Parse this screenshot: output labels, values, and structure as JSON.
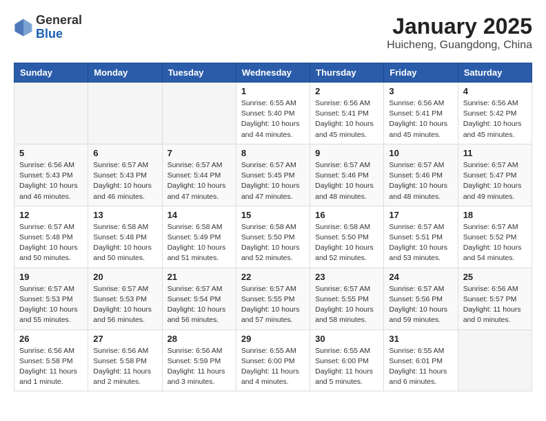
{
  "header": {
    "logo_general": "General",
    "logo_blue": "Blue",
    "title": "January 2025",
    "location": "Huicheng, Guangdong, China"
  },
  "weekdays": [
    "Sunday",
    "Monday",
    "Tuesday",
    "Wednesday",
    "Thursday",
    "Friday",
    "Saturday"
  ],
  "weeks": [
    [
      {
        "day": "",
        "info": ""
      },
      {
        "day": "",
        "info": ""
      },
      {
        "day": "",
        "info": ""
      },
      {
        "day": "1",
        "info": "Sunrise: 6:55 AM\nSunset: 5:40 PM\nDaylight: 10 hours\nand 44 minutes."
      },
      {
        "day": "2",
        "info": "Sunrise: 6:56 AM\nSunset: 5:41 PM\nDaylight: 10 hours\nand 45 minutes."
      },
      {
        "day": "3",
        "info": "Sunrise: 6:56 AM\nSunset: 5:41 PM\nDaylight: 10 hours\nand 45 minutes."
      },
      {
        "day": "4",
        "info": "Sunrise: 6:56 AM\nSunset: 5:42 PM\nDaylight: 10 hours\nand 45 minutes."
      }
    ],
    [
      {
        "day": "5",
        "info": "Sunrise: 6:56 AM\nSunset: 5:43 PM\nDaylight: 10 hours\nand 46 minutes."
      },
      {
        "day": "6",
        "info": "Sunrise: 6:57 AM\nSunset: 5:43 PM\nDaylight: 10 hours\nand 46 minutes."
      },
      {
        "day": "7",
        "info": "Sunrise: 6:57 AM\nSunset: 5:44 PM\nDaylight: 10 hours\nand 47 minutes."
      },
      {
        "day": "8",
        "info": "Sunrise: 6:57 AM\nSunset: 5:45 PM\nDaylight: 10 hours\nand 47 minutes."
      },
      {
        "day": "9",
        "info": "Sunrise: 6:57 AM\nSunset: 5:46 PM\nDaylight: 10 hours\nand 48 minutes."
      },
      {
        "day": "10",
        "info": "Sunrise: 6:57 AM\nSunset: 5:46 PM\nDaylight: 10 hours\nand 48 minutes."
      },
      {
        "day": "11",
        "info": "Sunrise: 6:57 AM\nSunset: 5:47 PM\nDaylight: 10 hours\nand 49 minutes."
      }
    ],
    [
      {
        "day": "12",
        "info": "Sunrise: 6:57 AM\nSunset: 5:48 PM\nDaylight: 10 hours\nand 50 minutes."
      },
      {
        "day": "13",
        "info": "Sunrise: 6:58 AM\nSunset: 5:48 PM\nDaylight: 10 hours\nand 50 minutes."
      },
      {
        "day": "14",
        "info": "Sunrise: 6:58 AM\nSunset: 5:49 PM\nDaylight: 10 hours\nand 51 minutes."
      },
      {
        "day": "15",
        "info": "Sunrise: 6:58 AM\nSunset: 5:50 PM\nDaylight: 10 hours\nand 52 minutes."
      },
      {
        "day": "16",
        "info": "Sunrise: 6:58 AM\nSunset: 5:50 PM\nDaylight: 10 hours\nand 52 minutes."
      },
      {
        "day": "17",
        "info": "Sunrise: 6:57 AM\nSunset: 5:51 PM\nDaylight: 10 hours\nand 53 minutes."
      },
      {
        "day": "18",
        "info": "Sunrise: 6:57 AM\nSunset: 5:52 PM\nDaylight: 10 hours\nand 54 minutes."
      }
    ],
    [
      {
        "day": "19",
        "info": "Sunrise: 6:57 AM\nSunset: 5:53 PM\nDaylight: 10 hours\nand 55 minutes."
      },
      {
        "day": "20",
        "info": "Sunrise: 6:57 AM\nSunset: 5:53 PM\nDaylight: 10 hours\nand 56 minutes."
      },
      {
        "day": "21",
        "info": "Sunrise: 6:57 AM\nSunset: 5:54 PM\nDaylight: 10 hours\nand 56 minutes."
      },
      {
        "day": "22",
        "info": "Sunrise: 6:57 AM\nSunset: 5:55 PM\nDaylight: 10 hours\nand 57 minutes."
      },
      {
        "day": "23",
        "info": "Sunrise: 6:57 AM\nSunset: 5:55 PM\nDaylight: 10 hours\nand 58 minutes."
      },
      {
        "day": "24",
        "info": "Sunrise: 6:57 AM\nSunset: 5:56 PM\nDaylight: 10 hours\nand 59 minutes."
      },
      {
        "day": "25",
        "info": "Sunrise: 6:56 AM\nSunset: 5:57 PM\nDaylight: 11 hours\nand 0 minutes."
      }
    ],
    [
      {
        "day": "26",
        "info": "Sunrise: 6:56 AM\nSunset: 5:58 PM\nDaylight: 11 hours\nand 1 minute."
      },
      {
        "day": "27",
        "info": "Sunrise: 6:56 AM\nSunset: 5:58 PM\nDaylight: 11 hours\nand 2 minutes."
      },
      {
        "day": "28",
        "info": "Sunrise: 6:56 AM\nSunset: 5:59 PM\nDaylight: 11 hours\nand 3 minutes."
      },
      {
        "day": "29",
        "info": "Sunrise: 6:55 AM\nSunset: 6:00 PM\nDaylight: 11 hours\nand 4 minutes."
      },
      {
        "day": "30",
        "info": "Sunrise: 6:55 AM\nSunset: 6:00 PM\nDaylight: 11 hours\nand 5 minutes."
      },
      {
        "day": "31",
        "info": "Sunrise: 6:55 AM\nSunset: 6:01 PM\nDaylight: 11 hours\nand 6 minutes."
      },
      {
        "day": "",
        "info": ""
      }
    ]
  ]
}
